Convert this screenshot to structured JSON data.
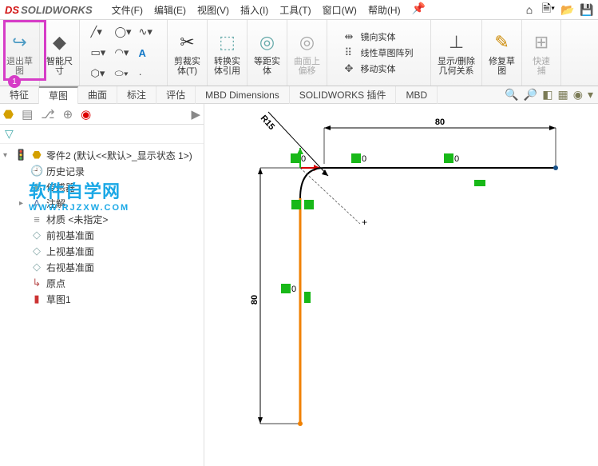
{
  "app": {
    "brand_ds": "DS",
    "brand_name": "SOLIDWORKS"
  },
  "menus": {
    "file": "文件(F)",
    "edit": "编辑(E)",
    "view": "视图(V)",
    "insert": "插入(I)",
    "tools": "工具(T)",
    "window": "窗口(W)",
    "help": "帮助(H)"
  },
  "ribbon": {
    "exit_sketch": "退出草\n图",
    "smart_dim": "智能尺\n寸",
    "trim": "剪裁实\n体(T)",
    "convert": "转换实\n体引用",
    "offset": "等距实\n体",
    "surface_offset": "曲面上\n偏移",
    "mirror": "镜向实体",
    "pattern": "线性草图阵列",
    "move": "移动实体",
    "show_rel": "显示/删除\n几何关系",
    "repair": "修复草\n图",
    "quick": "快速\n捕"
  },
  "tabs": [
    "特征",
    "草图",
    "曲面",
    "标注",
    "评估",
    "MBD Dimensions",
    "SOLIDWORKS 插件",
    "MBD"
  ],
  "tree": {
    "root": "零件2 (默认<<默认>_显示状态 1>)",
    "history": "历史记录",
    "sensors": "传感器",
    "annotations": "注解",
    "material": "材质 <未指定>",
    "front": "前视基准面",
    "top": "上视基准面",
    "right": "右视基准面",
    "origin": "原点",
    "sketch1": "草图1"
  },
  "watermark": {
    "cn": "软件自学网",
    "en": "WWW.RJZXW.COM"
  },
  "dims": {
    "top": "80",
    "left": "80",
    "radius": "R15"
  },
  "highlight_badge": "1"
}
